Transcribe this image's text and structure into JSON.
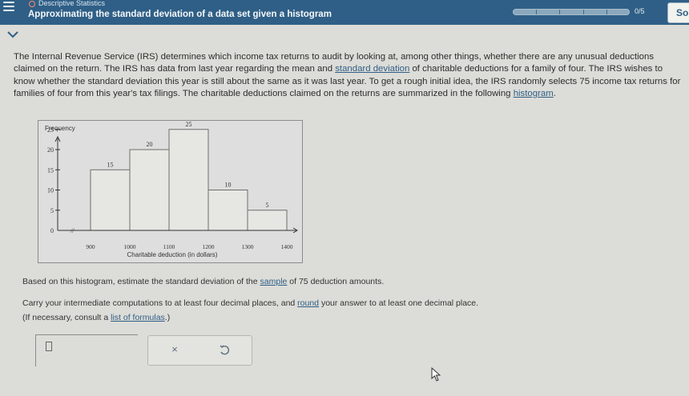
{
  "header": {
    "topic": "Descriptive Statistics",
    "title": "Approximating the standard deviation of a data set given a histogram",
    "progress_text": "0/5",
    "progress_fraction": 0,
    "solve_label": "So"
  },
  "problem": {
    "text_1": "The Internal Revenue Service (IRS) determines which income tax returns to audit by looking at, among other things, whether there are any unusual deductions claimed on the return. The IRS has data from last year regarding the mean and ",
    "link_sd": "standard deviation",
    "text_2": " of charitable deductions for a family of four. The IRS wishes to know whether the standard deviation this year is still about the same as it was last year. To get a rough initial idea, the IRS randomly selects 75 income tax returns for families of four from this year's tax filings. The charitable deductions claimed on the returns are summarized in the following ",
    "link_histogram": "histogram",
    "text_3": "."
  },
  "chart_data": {
    "type": "bar",
    "ylabel": "Frequency",
    "xlabel": "Charitable deduction (in dollars)",
    "bins": [
      {
        "from": 900,
        "to": 1000,
        "value": 15
      },
      {
        "from": 1000,
        "to": 1100,
        "value": 20
      },
      {
        "from": 1100,
        "to": 1200,
        "value": 25
      },
      {
        "from": 1200,
        "to": 1300,
        "value": 10
      },
      {
        "from": 1300,
        "to": 1400,
        "value": 5
      }
    ],
    "value_labels": [
      "15",
      "20",
      "25",
      "10",
      "5"
    ],
    "x_ticks": [
      "900",
      "1000",
      "1100",
      "1200",
      "1300",
      "1400"
    ],
    "y_ticks": [
      "0",
      "5",
      "10",
      "15",
      "20",
      "25"
    ],
    "ylim": [
      0,
      30
    ],
    "xlim": [
      900,
      1400
    ],
    "axis_break": "//"
  },
  "question": {
    "q1_a": "Based on this histogram, estimate the standard deviation of the ",
    "q1_link": "sample",
    "q1_b": " of 75 deduction amounts.",
    "q2_a": "Carry your intermediate computations to at least four decimal places, and ",
    "q2_link": "round",
    "q2_b": " your answer to at least one decimal place.",
    "q3_a": "(If necessary, consult a ",
    "q3_link": "list of formulas",
    "q3_b": ".)"
  },
  "tools": {
    "clear_glyph": "×",
    "clear_icon": "close-icon",
    "undo_icon": "undo-icon"
  },
  "colors": {
    "header_bg": "#2f5f86",
    "link": "#2f5f86",
    "bar_fill": "#e6e6e3"
  }
}
